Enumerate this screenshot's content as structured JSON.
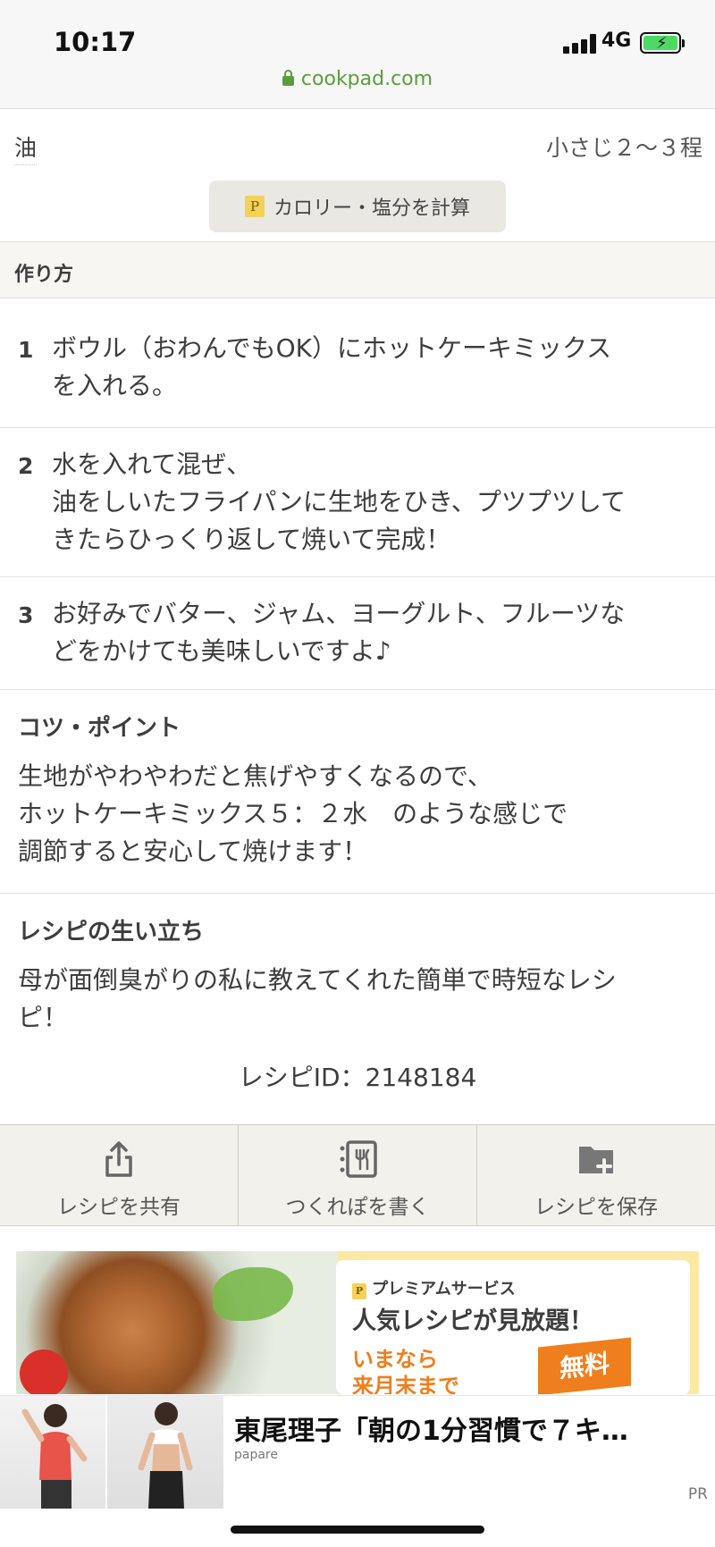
{
  "status": {
    "time": "10:17",
    "network": "4G",
    "url": "cookpad.com"
  },
  "ingredient": {
    "name": "油",
    "qty": "小さじ２〜３程"
  },
  "calc_button": "カロリー・塩分を計算",
  "steps_header": "作り方",
  "steps": [
    {
      "num": "1",
      "text": "ボウル（おわんでもOK）にホットケーキミックス\nを入れる。"
    },
    {
      "num": "2",
      "text": "水を入れて混ぜ、\n油をしいたフライパンに生地をひき、プツプツして\nきたらひっくり返して焼いて完成！"
    },
    {
      "num": "3",
      "text": "お好みでバター、ジャム、ヨーグルト、フルーツな\nどをかけても美味しいですよ♪"
    }
  ],
  "tips": {
    "title": "コツ・ポイント",
    "text": "生地がやわやわだと焦げやすくなるので、\nホットケーキミックス５：２水　のような感じで\n調節すると安心して焼けます！"
  },
  "history": {
    "title": "レシピの生い立ち",
    "text": "母が面倒臭がりの私に教えてくれた簡単で時短なレシ\nピ！"
  },
  "recipe_id": "レシピID：2148184",
  "actions": {
    "share": "レシピを共有",
    "tsukurepo": "つくれぽを書く",
    "save": "レシピを保存"
  },
  "promo": {
    "small": "プレミアムサービス",
    "big": "人気レシピが見放題！",
    "orange_line1": "いまなら",
    "orange_line2": "来月末まで",
    "free": "無料"
  },
  "ad": {
    "title": "東尾理子「朝の1分習慣で７キ…",
    "source": "papare",
    "pr": "PR"
  },
  "colors": {
    "accent_green": "#5a9e3a",
    "promo_orange": "#ef7e1d",
    "promo_yellow": "#fbe9a4"
  }
}
